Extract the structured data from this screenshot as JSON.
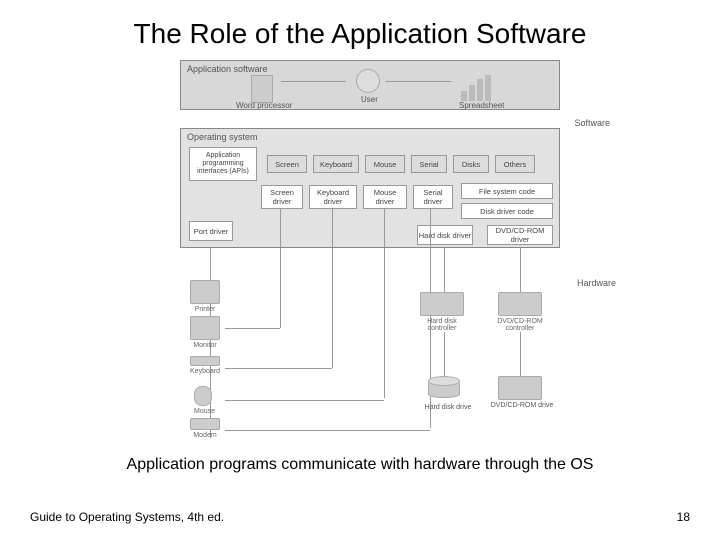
{
  "title": "The Role of the Application Software",
  "caption": "Application programs communicate with hardware through the OS",
  "footer_left": "Guide to Operating Systems, 4th ed.",
  "footer_right": "18",
  "labels": {
    "app_software": "Application software",
    "os": "Operating system",
    "software": "Software",
    "hardware": "Hardware",
    "api": "Application programming interfaces (APIs)",
    "user": "User",
    "word_proc": "Word processor",
    "spreadsheet": "Spreadsheet"
  },
  "api_boxes": [
    "Screen",
    "Keyboard",
    "Mouse",
    "Serial",
    "Disks",
    "Others"
  ],
  "driver_row": [
    "Screen driver",
    "Keyboard driver",
    "Mouse driver",
    "Serial driver"
  ],
  "fs_box": "File system code",
  "disk_driver_box": "Disk driver code",
  "port_driver": "Port driver",
  "hdd_driver": "Hard disk driver",
  "dvd_driver": "DVD/CD-ROM driver",
  "hw": {
    "printer": "Printer",
    "monitor": "Monitor",
    "keyboard": "Keyboard",
    "mouse": "Mouse",
    "modem": "Modem",
    "hdd_ctrl": "Hard disk controller",
    "dvd_ctrl": "DVD/CD-ROM controller",
    "hdd": "Hard disk drive",
    "dvd": "DVD/CD-ROM drive"
  }
}
